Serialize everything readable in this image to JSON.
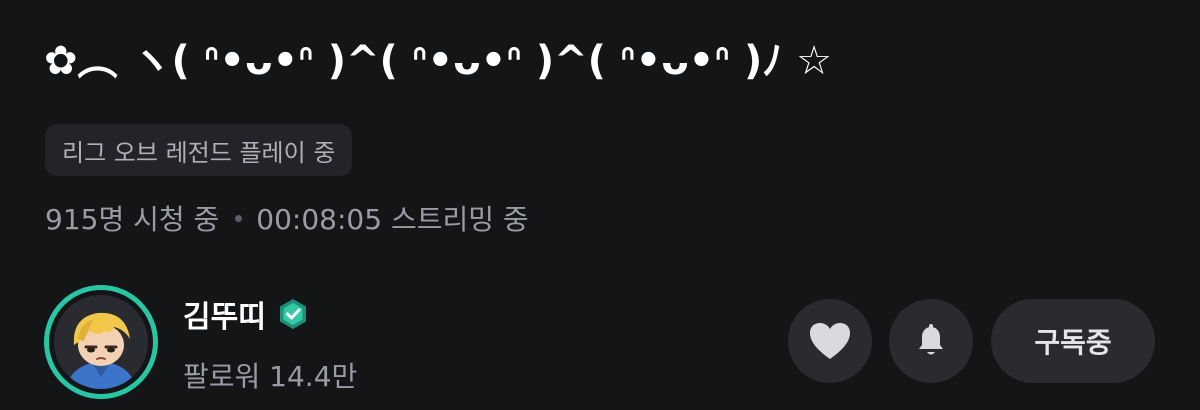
{
  "stream": {
    "title": "✿︵ ヽ( ᐢ•ᴗ•ᐢ )^( ᐢ•ᴗ•ᐢ )^( ᐢ•ᴗ•ᐢ )ﾉ ☆",
    "category": "리그 오브 레전드 플레이 중",
    "viewers": "915명 시청 중",
    "duration": "00:08:05 스트리밍 중"
  },
  "streamer": {
    "name": "김뚜띠",
    "followers": "팔로워 14.4만",
    "verified": true
  },
  "actions": {
    "like_icon": "heart-icon",
    "notify_icon": "bell-icon",
    "subscribe_label": "구독중"
  },
  "colors": {
    "background": "#141517",
    "accent_ring": "#28c7a4",
    "chip_bg": "#232428",
    "button_bg": "#2a2b2f",
    "muted_text": "#9a9ca3"
  }
}
